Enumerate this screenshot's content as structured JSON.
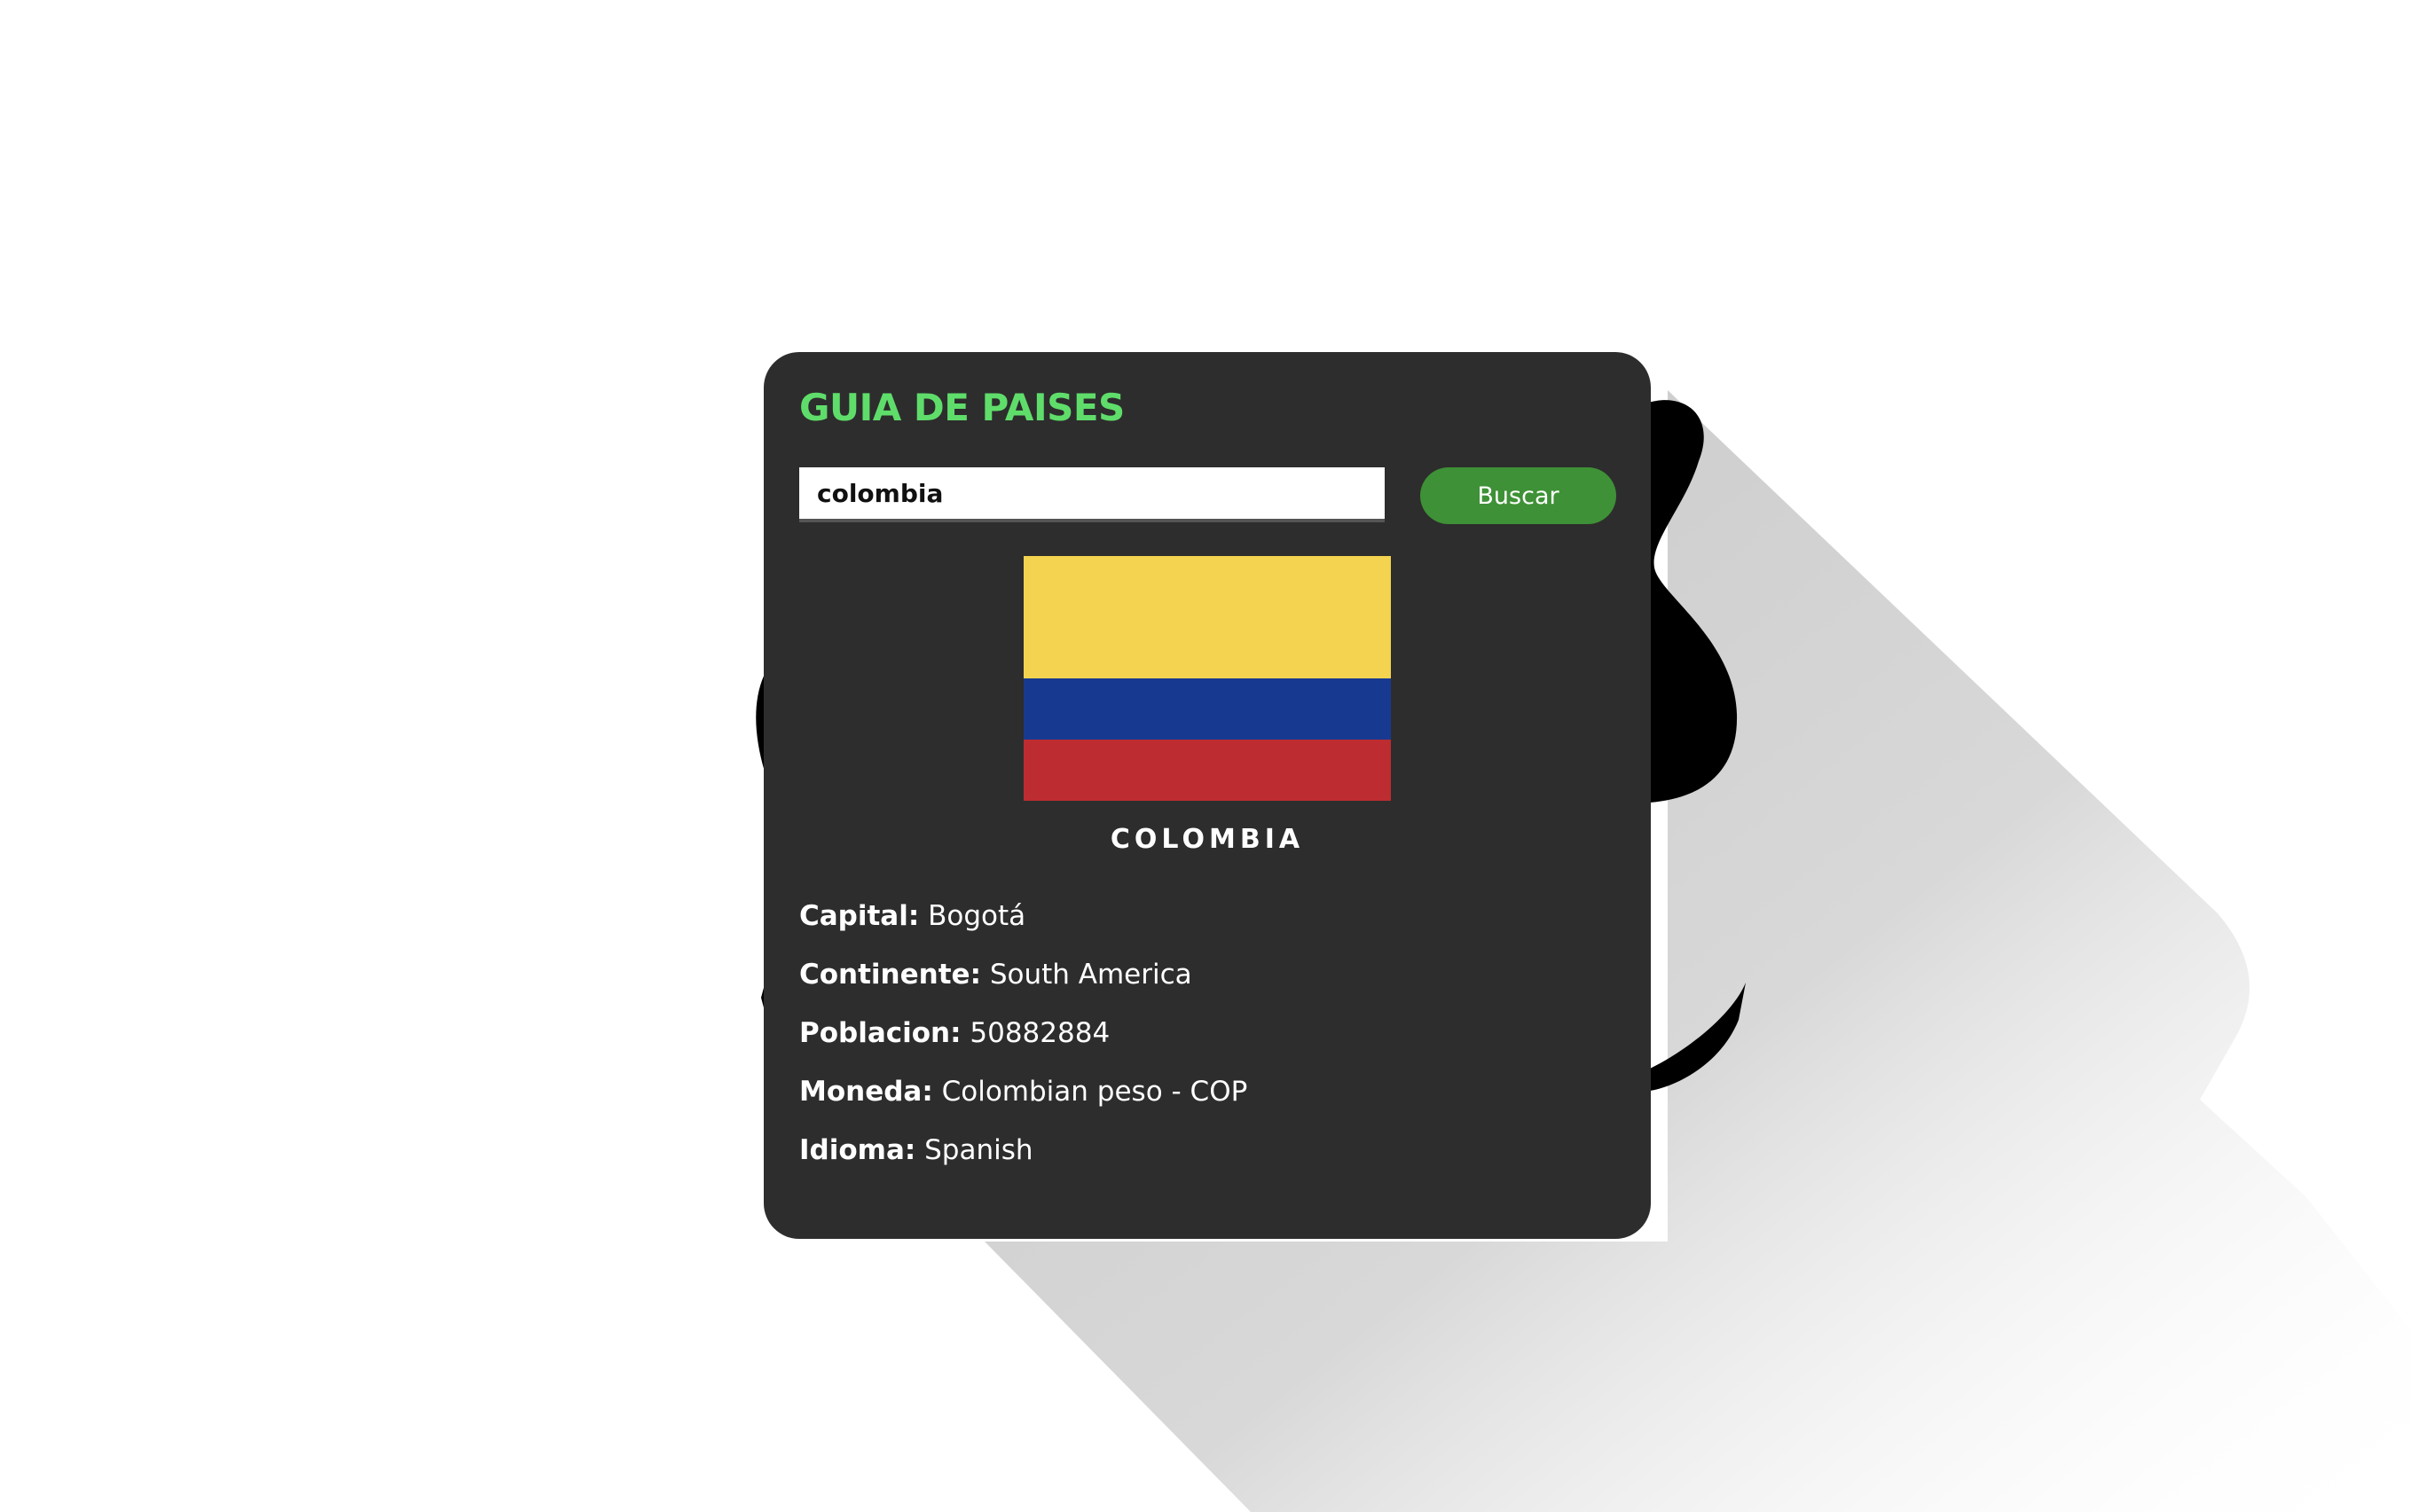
{
  "app": {
    "title": "GUIA DE PAISES"
  },
  "search": {
    "value": "colombia",
    "button_label": "Buscar"
  },
  "country": {
    "name": "COLOMBIA",
    "flag_colors": [
      "#f3d34f",
      "#173990",
      "#bd2c30"
    ],
    "details": [
      {
        "label": "Capital:",
        "value": "Bogotá"
      },
      {
        "label": "Continente:",
        "value": "South America"
      },
      {
        "label": "Poblacion:",
        "value": "50882884"
      },
      {
        "label": "Moneda:",
        "value": "Colombian peso - COP"
      },
      {
        "label": "Idioma:",
        "value": "Spanish"
      }
    ]
  },
  "colors": {
    "card_background": "#2d2d2d",
    "title_accent": "#5fdd6a",
    "button_background": "#3e9136",
    "page_background": "#ffffff"
  }
}
